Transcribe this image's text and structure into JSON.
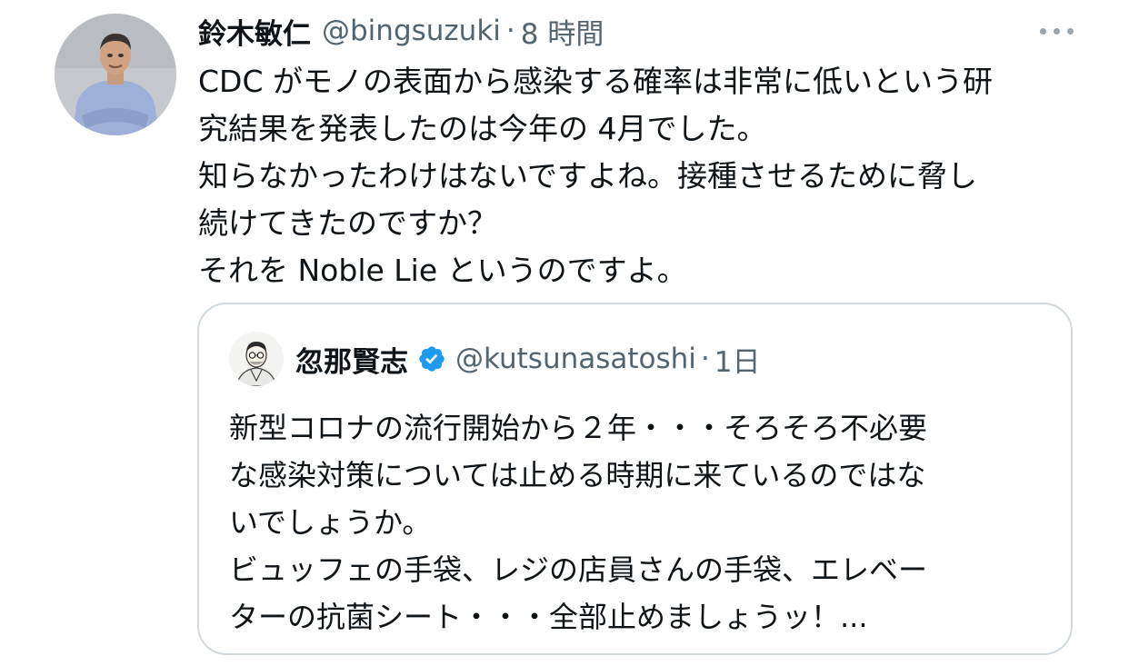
{
  "tweet": {
    "author_name": "鈴木敏仁",
    "author_handle": "@bingsuzuki",
    "separator": "·",
    "timestamp": "8 時間",
    "more_icon": "more-horizontal-icon",
    "text_lines": [
      "CDC がモノの表面から感染する確率は非常に低いという研",
      "究結果を発表したのは今年の 4月でした。",
      "知らなかったわけはないですよね。接種させるために脅し",
      "続けてきたのですか？",
      "それを Noble Lie というのですよ。"
    ]
  },
  "quote": {
    "author_name": "忽那賢志",
    "verified_icon": "verified-badge-icon",
    "author_handle": "@kutsunasatoshi",
    "separator": "·",
    "timestamp": "1日",
    "text_lines": [
      "新型コロナの流行開始から２年・・・そろそろ不必要",
      "な感染対策については止める時期に来ているのではな",
      "いでしょうか。",
      "ビュッフェの手袋、レジの店員さんの手袋、エレベー",
      "ターの抗菌シート・・・全部止めましょうッ！..."
    ]
  },
  "colors": {
    "text": "#0f1419",
    "secondary_text": "#536471",
    "border": "#cfd9de",
    "verified": "#1d9bf0"
  }
}
